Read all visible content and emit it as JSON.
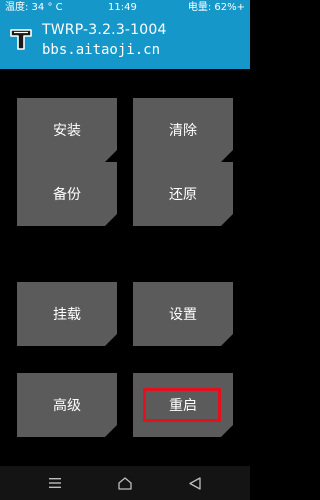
{
  "status_bar": {
    "temperature": "温度: 34 ° C",
    "time": "11:49",
    "battery": "电量: 62%+"
  },
  "header": {
    "title": "TWRP-3.2.3-1004",
    "subtitle": "bbs.aitaoji.cn",
    "logo_icon": "twrp-logo-icon"
  },
  "main_menu": {
    "install": "安装",
    "wipe": "清除",
    "backup": "备份",
    "restore": "还原",
    "mount": "挂载",
    "settings": "设置",
    "advanced": "高级",
    "reboot": "重启"
  },
  "highlight": {
    "target": "reboot",
    "color": "#e3101e"
  },
  "nav_bar": {
    "menu_icon": "menu-icon",
    "home_icon": "home-icon",
    "back_icon": "back-icon"
  },
  "colors": {
    "header_bg": "#1597c9",
    "tile_bg": "#5b5b5b",
    "background": "#000000",
    "nav_bg": "#141414"
  }
}
